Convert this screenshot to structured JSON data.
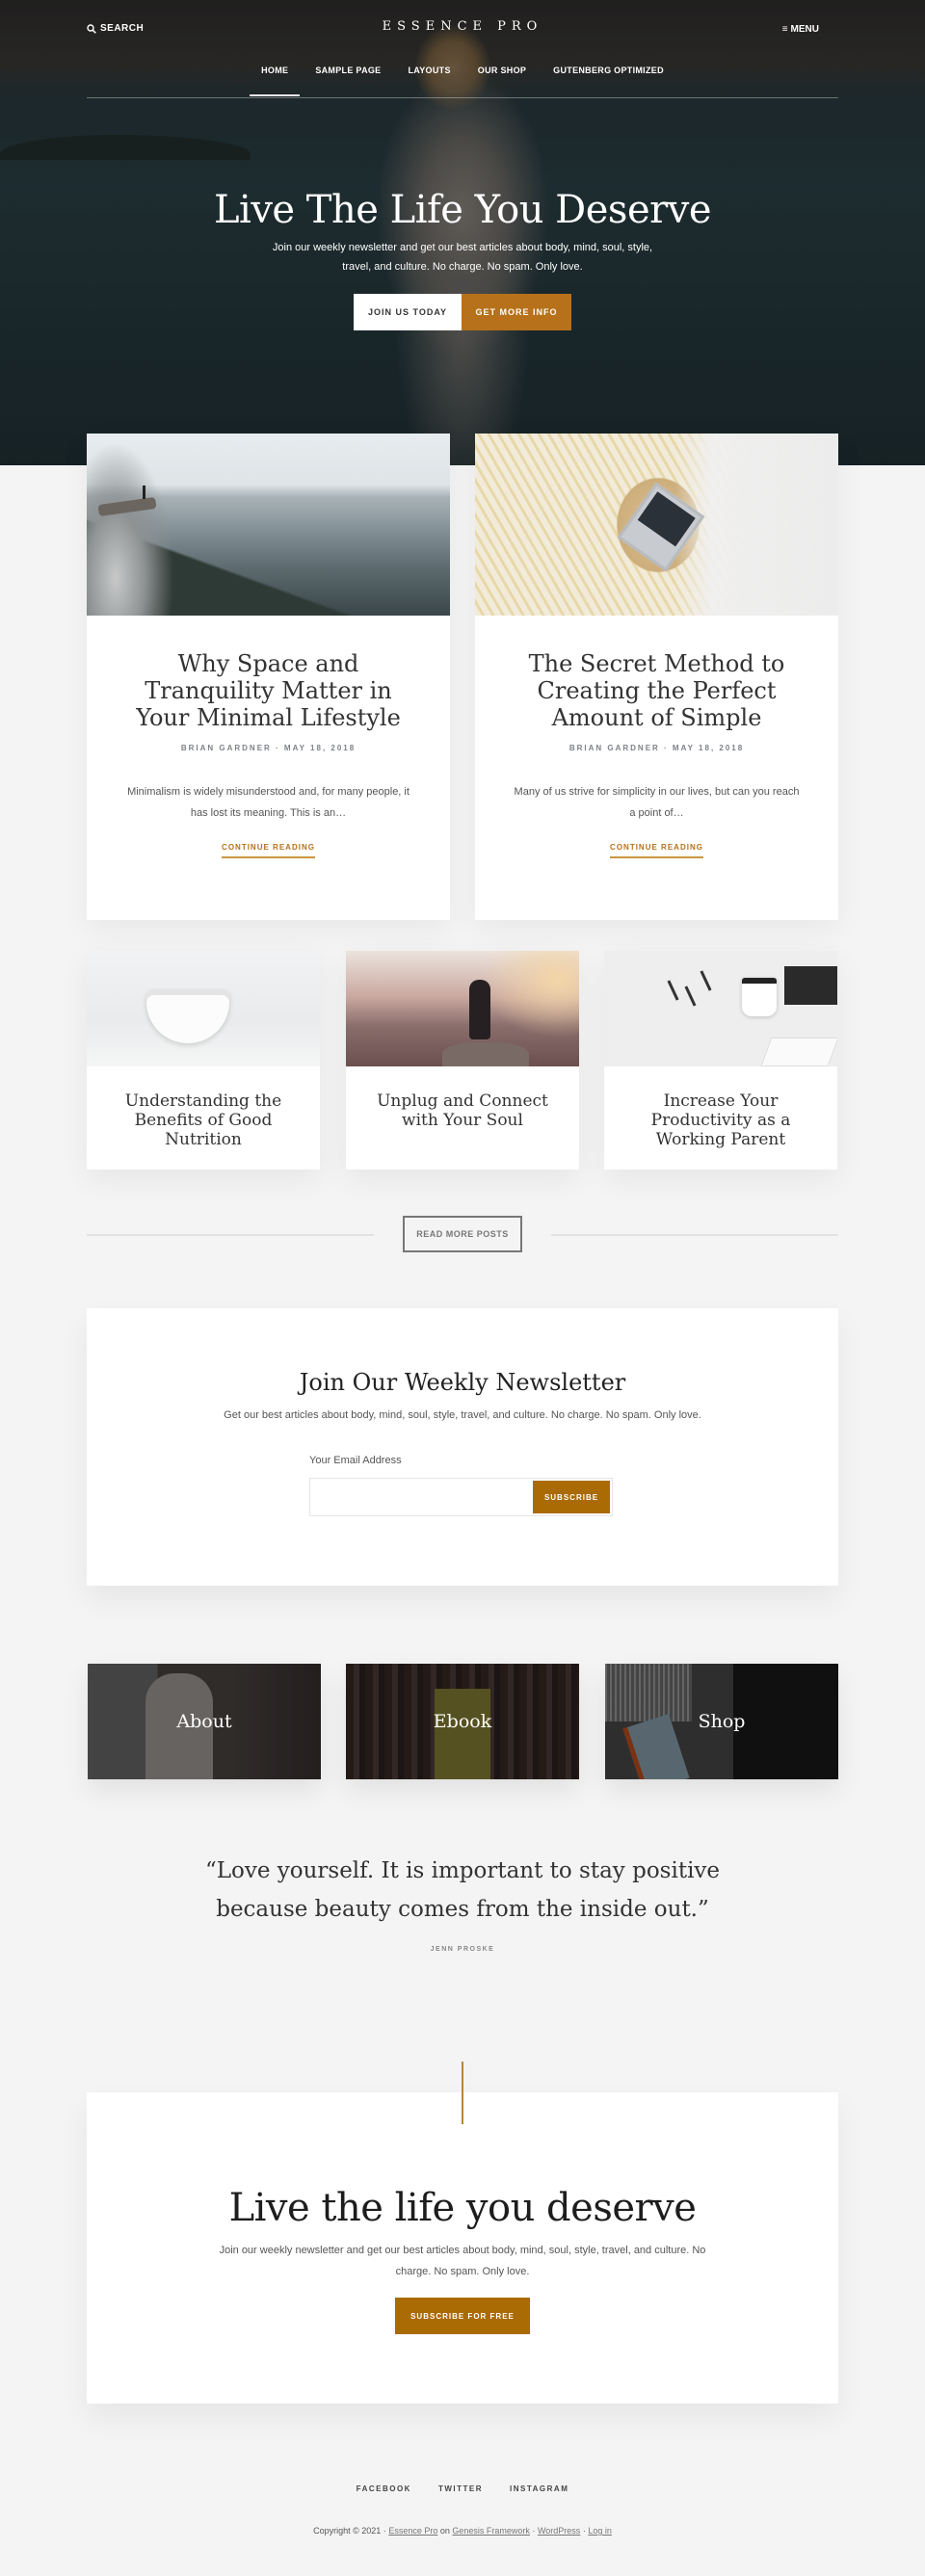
{
  "header": {
    "search_label": "SEARCH",
    "site_title": "ESSENCE PRO",
    "menu_label": "MENU",
    "nav": [
      {
        "label": "HOME",
        "active": true
      },
      {
        "label": "SAMPLE PAGE"
      },
      {
        "label": "LAYOUTS"
      },
      {
        "label": "OUR SHOP"
      },
      {
        "label": "GUTENBERG OPTIMIZED"
      }
    ]
  },
  "hero": {
    "title": "Live The Life You Deserve",
    "text": "Join our weekly newsletter and get our best articles about body, mind, soul, style, travel, and culture. No charge. No spam. Only love.",
    "primary_button": "JOIN US TODAY",
    "secondary_button": "GET MORE INFO"
  },
  "featured_posts": [
    {
      "title": "Why Space and Tranquility Matter in Your Minimal Lifestyle",
      "meta": "BRIAN GARDNER · MAY 18, 2018",
      "excerpt": "Minimalism is widely misunderstood and, for many people, it has lost its meaning. This is an…",
      "more": "CONTINUE READING",
      "image": "mountain-cliff-image"
    },
    {
      "title": "The Secret Method to Creating the Perfect Amount of Simple",
      "meta": "BRIAN GARDNER · MAY 18, 2018",
      "excerpt": "Many of us strive for simplicity in our lives, but can you reach a point of…",
      "more": "CONTINUE READING",
      "image": "laptop-tray-image"
    }
  ],
  "small_posts": [
    {
      "title": "Understanding the Benefits of Good Nutrition",
      "image": "white-bowls-image"
    },
    {
      "title": "Unplug and Connect with Your Soul",
      "image": "sunset-mountain-image"
    },
    {
      "title": "Increase Your Productivity as a Working Parent",
      "image": "desk-coffee-image"
    }
  ],
  "read_more": {
    "label": "READ MORE POSTS"
  },
  "newsletter": {
    "title": "Join Our Weekly Newsletter",
    "text": "Get our best articles about body, mind, soul, style, travel, and culture. No charge. No spam. Only love.",
    "email_label": "Your Email Address",
    "email_value": "",
    "email_placeholder": "",
    "submit": "SUBSCRIBE"
  },
  "tiles": [
    {
      "label": "About"
    },
    {
      "label": "Ebook"
    },
    {
      "label": "Shop"
    }
  ],
  "quote": {
    "text": "“Love yourself. It is important to stay positive because beauty comes from the inside out.”",
    "author": "JENN PROSKE"
  },
  "cta": {
    "title": "Live the life you deserve",
    "text": "Join our weekly newsletter and get our best articles about body, mind, soul, style, travel, and culture. No charge. No spam. Only love.",
    "button": "SUBSCRIBE FOR FREE"
  },
  "footer": {
    "social": [
      "FACEBOOK",
      "TWITTER",
      "INSTAGRAM"
    ],
    "copyright_prefix": "Copyright © 2021 ·",
    "theme_link": "Essence Pro",
    "on": "on",
    "framework_link": "Genesis Framework",
    "sep1": "·",
    "wordpress_link": "WordPress",
    "sep2": "·",
    "login_link": "Log in"
  },
  "colors": {
    "accent": "#aa6a04",
    "accent_light": "#b6711a",
    "background": "#f4f4f4",
    "card": "#ffffff"
  }
}
